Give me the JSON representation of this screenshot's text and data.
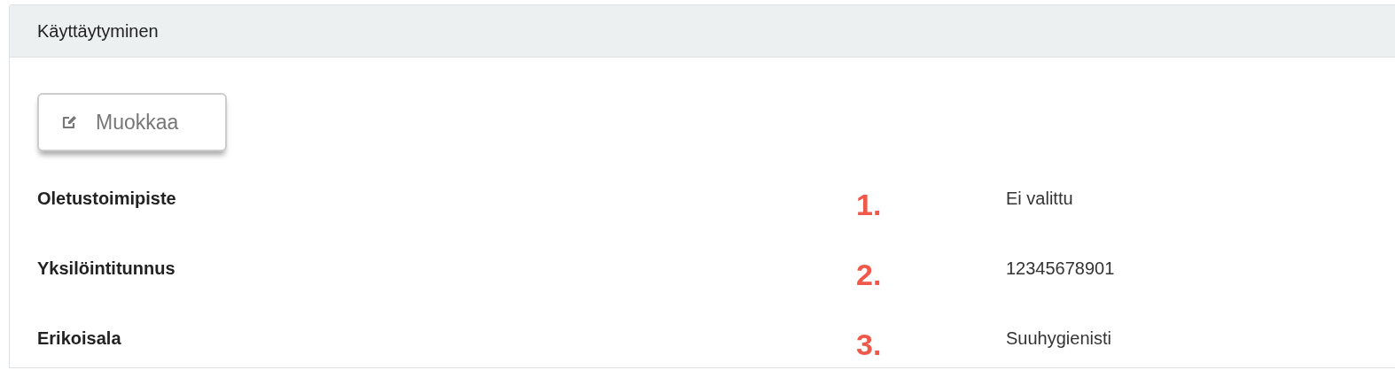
{
  "panel": {
    "title": "Käyttäytyminen"
  },
  "edit_button": {
    "label": "Muokkaa"
  },
  "fields": [
    {
      "label": "Oletustoimipiste",
      "marker": "1.",
      "value": "Ei valittu"
    },
    {
      "label": "Yksilöintitunnus",
      "marker": "2.",
      "value": "12345678901"
    },
    {
      "label": "Erikoisala",
      "marker": "3.",
      "value": "Suuhygienisti"
    }
  ]
}
